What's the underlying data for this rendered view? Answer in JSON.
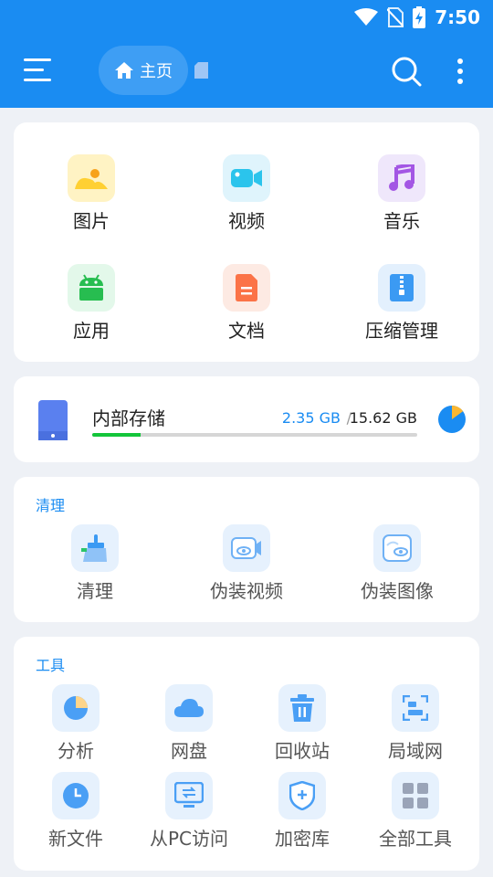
{
  "status_bar": {
    "time": "7:50"
  },
  "header": {
    "breadcrumb_label": "主页"
  },
  "categories": [
    {
      "label": "图片",
      "icon": "image-icon"
    },
    {
      "label": "视频",
      "icon": "video-icon"
    },
    {
      "label": "音乐",
      "icon": "music-icon"
    },
    {
      "label": "应用",
      "icon": "android-icon"
    },
    {
      "label": "文档",
      "icon": "document-icon"
    },
    {
      "label": "压缩管理",
      "icon": "archive-icon"
    }
  ],
  "storage": {
    "name": "内部存储",
    "used": "2.35 GB",
    "separator": "/",
    "total": "15.62 GB",
    "used_fraction": 0.15
  },
  "clean_section": {
    "title": "清理",
    "items": [
      {
        "label": "清理",
        "icon": "broom-icon"
      },
      {
        "label": "伪装视频",
        "icon": "disguise-video-icon"
      },
      {
        "label": "伪装图像",
        "icon": "disguise-image-icon"
      }
    ]
  },
  "tools_section": {
    "title": "工具",
    "items": [
      {
        "label": "分析",
        "icon": "analysis-pie-icon"
      },
      {
        "label": "网盘",
        "icon": "cloud-icon"
      },
      {
        "label": "回收站",
        "icon": "trash-icon"
      },
      {
        "label": "局域网",
        "icon": "lan-icon"
      },
      {
        "label": "新文件",
        "icon": "clock-icon"
      },
      {
        "label": "从PC访问",
        "icon": "pc-access-icon"
      },
      {
        "label": "加密库",
        "icon": "vault-shield-icon"
      },
      {
        "label": "全部工具",
        "icon": "all-tools-icon"
      }
    ]
  },
  "colors": {
    "accent": "#1a8cf2",
    "background": "#eef1f6",
    "progress": "#13c53a"
  }
}
